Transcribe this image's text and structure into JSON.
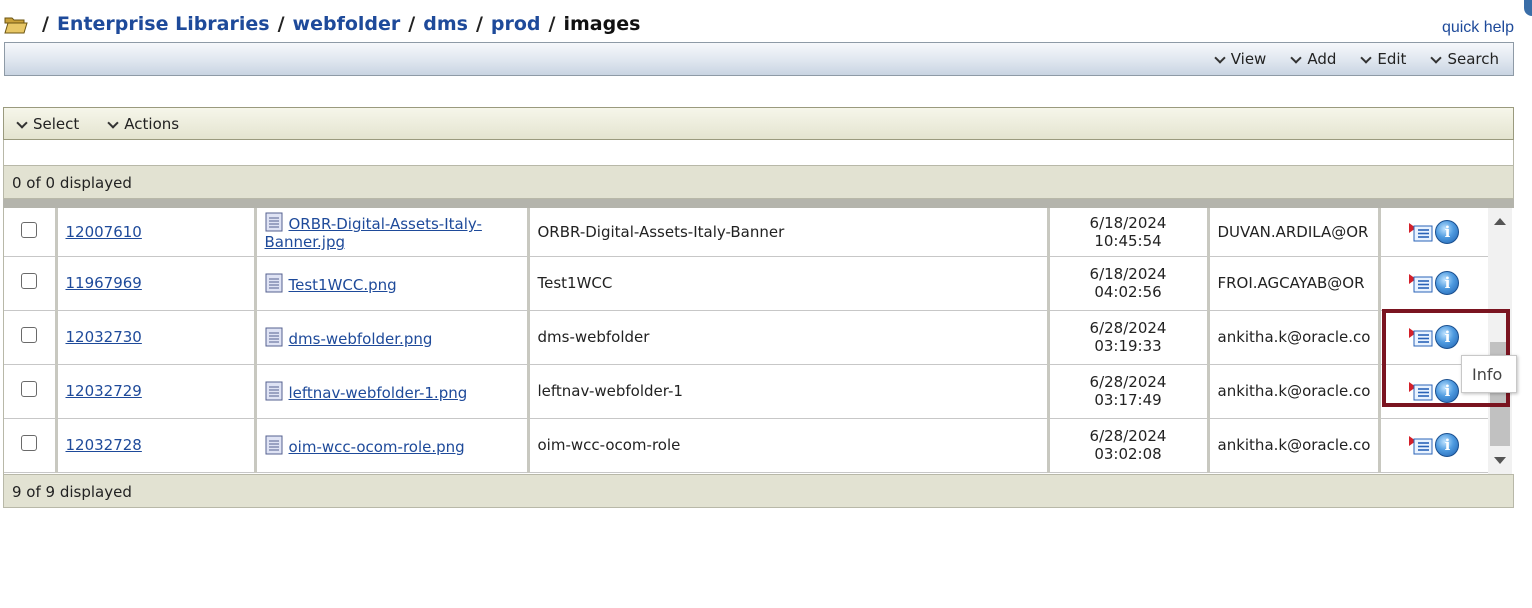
{
  "breadcrumb": {
    "separator": "/",
    "items": [
      {
        "label": "Enterprise Libraries"
      },
      {
        "label": "webfolder"
      },
      {
        "label": "dms"
      },
      {
        "label": "prod"
      }
    ],
    "current": "images"
  },
  "quick_help": "quick help",
  "toolbar": {
    "menus": [
      {
        "label": "View"
      },
      {
        "label": "Add"
      },
      {
        "label": "Edit"
      },
      {
        "label": "Search"
      }
    ]
  },
  "list": {
    "menus": [
      {
        "label": "Select"
      },
      {
        "label": "Actions"
      }
    ],
    "top_count": "0 of 0 displayed",
    "bottom_count": "9 of 9 displayed",
    "rows": [
      {
        "id": "12007610",
        "filename": "ORBR-Digital-Assets-Italy-Banner.jpg",
        "title": "ORBR-Digital-Assets-Italy-Banner",
        "date": "6/18/2024",
        "time": "10:45:54",
        "author": "DUVAN.ARDILA@OR"
      },
      {
        "id": "11967969",
        "filename": "Test1WCC.png",
        "title": "Test1WCC",
        "date": "6/18/2024",
        "time": "04:02:56",
        "author": "FROI.AGCAYAB@OR"
      },
      {
        "id": "12032730",
        "filename": "dms-webfolder.png",
        "title": "dms-webfolder",
        "date": "6/28/2024",
        "time": "03:19:33",
        "author": "ankitha.k@oracle.co"
      },
      {
        "id": "12032729",
        "filename": "leftnav-webfolder-1.png",
        "title": "leftnav-webfolder-1",
        "date": "6/28/2024",
        "time": "03:17:49",
        "author": "ankitha.k@oracle.co"
      },
      {
        "id": "12032728",
        "filename": "oim-wcc-ocom-role.png",
        "title": "oim-wcc-ocom-role",
        "date": "6/28/2024",
        "time": "03:02:08",
        "author": "ankitha.k@oracle.co"
      }
    ]
  },
  "tooltip": "Info",
  "icons": {
    "folder": "open-folder-icon",
    "file": "document-icon",
    "action": "content-actions-icon",
    "info": "info-icon",
    "info_glyph": "i"
  },
  "colors": {
    "link": "#1e4a9a",
    "highlight": "#7a1420",
    "toolbar": "#dfe6ef",
    "list_bar": "#e2e2d2"
  }
}
